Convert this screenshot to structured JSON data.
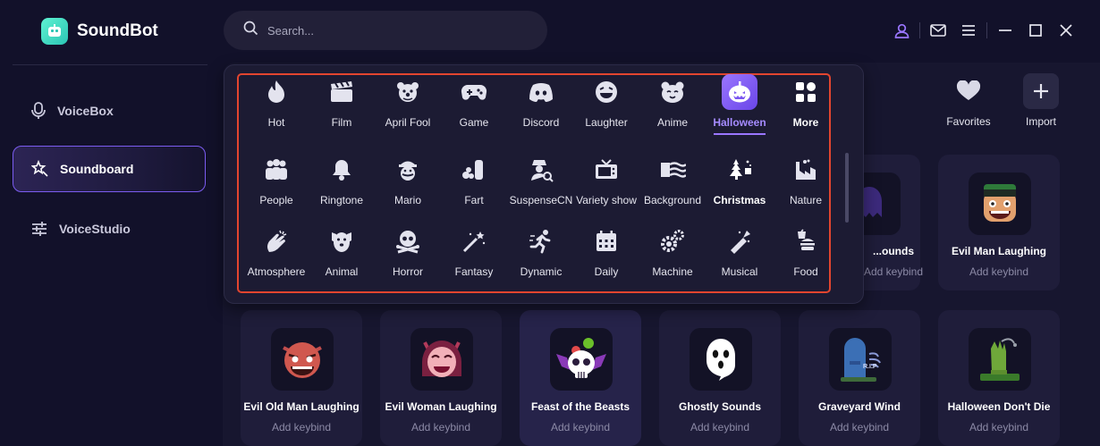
{
  "app": {
    "name": "SoundBot",
    "accent": "#7b5cf0",
    "brand": "#35d3bd"
  },
  "search": {
    "placeholder": "Search..."
  },
  "sidebar": {
    "items": [
      {
        "label": "VoiceBox",
        "icon": "microphone-icon",
        "active": false
      },
      {
        "label": "Soundboard",
        "icon": "soundboard-star-icon",
        "active": true
      },
      {
        "label": "VoiceStudio",
        "icon": "sliders-icon",
        "active": false
      }
    ]
  },
  "topbar": {
    "icons": [
      "user-icon",
      "mail-icon",
      "menu-icon",
      "minimize-icon",
      "maximize-icon",
      "close-icon"
    ]
  },
  "categories": [
    [
      "Hot",
      "Film",
      "April Fool",
      "Game",
      "Discord",
      "Laughter",
      "Anime",
      "Halloween",
      "More"
    ],
    [
      "People",
      "Ringtone",
      "Mario",
      "Fart",
      "SuspenseCN",
      "Variety show",
      "Background",
      "Christmas",
      "Nature"
    ],
    [
      "Atmosphere",
      "Animal",
      "Horror",
      "Fantasy",
      "Dynamic",
      "Daily",
      "Machine",
      "Musical",
      "Food"
    ]
  ],
  "selected_category": "Halloween",
  "quick_actions": {
    "favorites": "Favorites",
    "import": "Import"
  },
  "partial_cards": [
    {
      "name": "...ounds",
      "keybind": "Add keybind"
    },
    {
      "name": "Evil Man Laughing",
      "keybind": "Add keybind"
    }
  ],
  "cards": [
    {
      "name": "Evil Old Man Laughing",
      "keybind": "Add keybind"
    },
    {
      "name": "Evil Woman Laughing",
      "keybind": "Add keybind"
    },
    {
      "name": "Feast of the Beasts",
      "keybind": "Add keybind"
    },
    {
      "name": "Ghostly Sounds",
      "keybind": "Add keybind"
    },
    {
      "name": "Graveyard Wind",
      "keybind": "Add keybind"
    },
    {
      "name": "Halloween Don't Die",
      "keybind": "Add keybind"
    }
  ],
  "grave_text": "R.I.P"
}
